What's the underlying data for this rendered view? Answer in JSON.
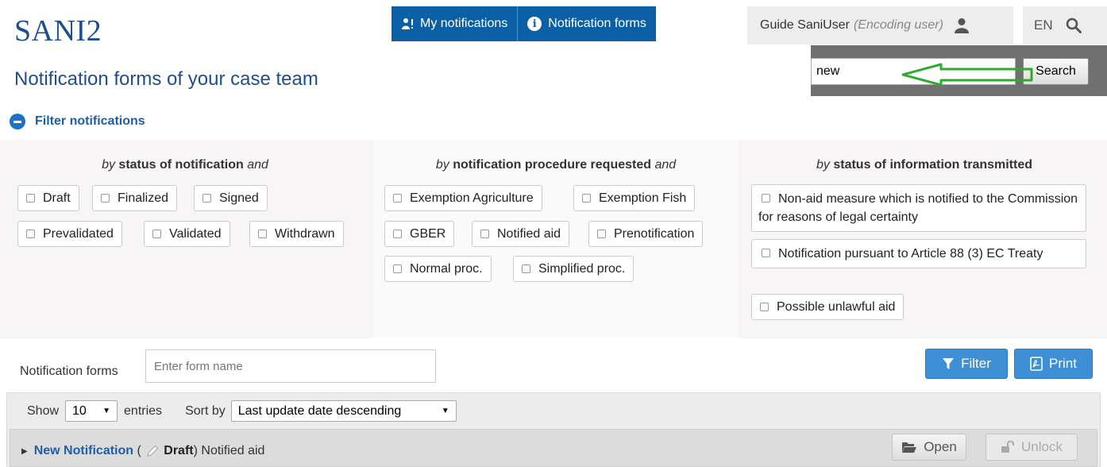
{
  "app": {
    "logo": "SANI2"
  },
  "topnav": {
    "my_notifications": "My notifications",
    "notification_forms": "Notification forms"
  },
  "user": {
    "name": "Guide SaniUser",
    "role": "(Encoding user)"
  },
  "language": "EN",
  "search": {
    "value": "new",
    "button": "Search"
  },
  "page": {
    "title": "Notification forms of your case team"
  },
  "filter": {
    "toggle_label": "Filter notifications",
    "columns": [
      {
        "prefix": "by",
        "heading": " status of notification ",
        "suffix": "and",
        "options": [
          "Draft",
          "Finalized",
          "Signed",
          "Prevalidated",
          "Validated",
          "Withdrawn"
        ]
      },
      {
        "prefix": "by",
        "heading": " notification procedure requested ",
        "suffix": "and",
        "options": [
          "Exemption Agriculture",
          "Exemption Fish",
          "GBER",
          "Notified aid",
          "Prenotification",
          "Normal proc.",
          "Simplified proc."
        ]
      },
      {
        "prefix": "by",
        "heading": " status of information transmitted",
        "suffix": "",
        "options": [
          "Non-aid measure which is notified to the Commission for reasons of legal certainty",
          "Notification pursuant to Article 88 (3) EC Treaty",
          "Possible unlawful aid"
        ]
      }
    ]
  },
  "forms": {
    "label": "Notification forms",
    "input_placeholder": "Enter form name",
    "filter_button": "Filter",
    "print_button": "Print"
  },
  "list": {
    "show_label": "Show",
    "entries_value": "10",
    "entries_label": "entries",
    "sort_label": "Sort by",
    "sort_value": "Last update date descending"
  },
  "row": {
    "name": "New Notification",
    "open_paren": " ( ",
    "status": "Draft",
    "close_paren": ")",
    "type": " Notified aid",
    "open_button": "Open",
    "unlock_button": "Unlock"
  },
  "colors": {
    "brand_blue": "#0b5fa5",
    "title_blue": "#1f4e8c",
    "button_blue": "#3d8fd6",
    "annotation_arrow": "#2faa2f"
  }
}
